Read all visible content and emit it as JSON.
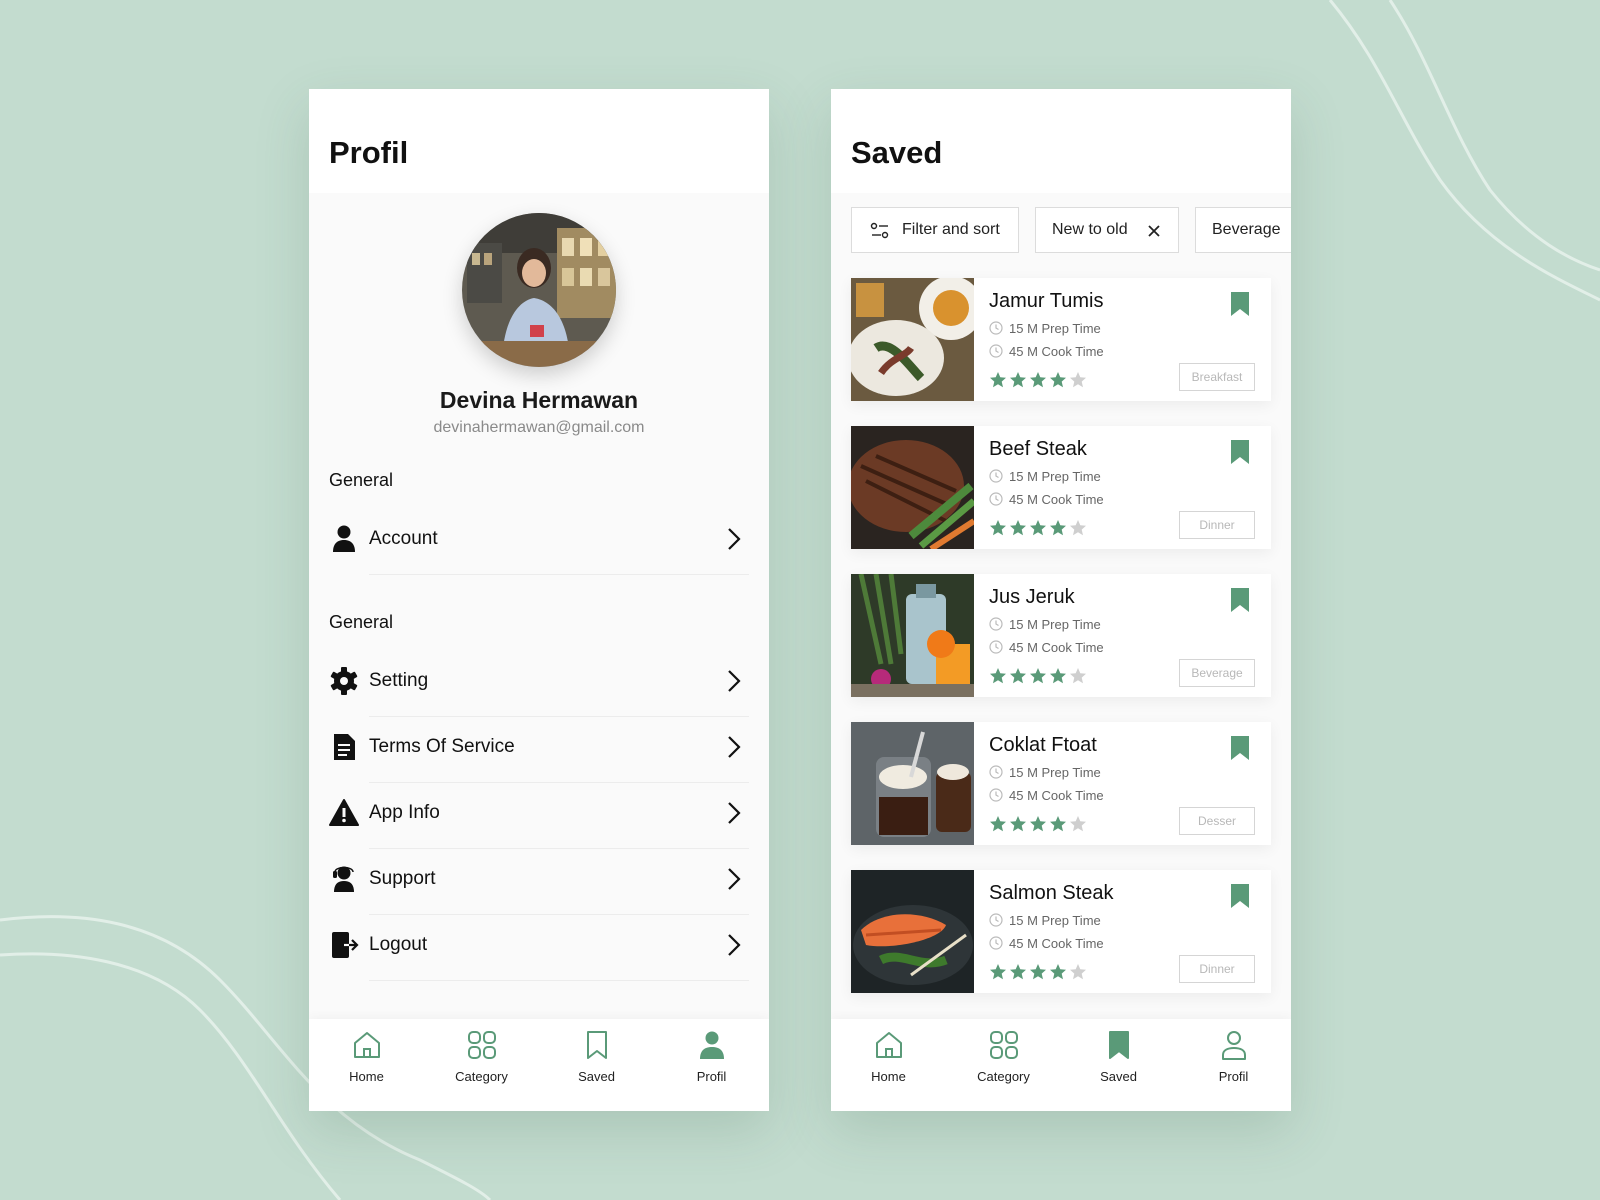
{
  "colors": {
    "accent": "#5a9a78",
    "background": "#c3dccf",
    "text": "#111111",
    "muted": "#8a8a8a"
  },
  "profile_screen": {
    "title": "Profil",
    "user": {
      "name": "Devina Hermawan",
      "email": "devinahermawan@gmail.com"
    },
    "sections": [
      {
        "label": "General",
        "items": [
          {
            "label": "Account",
            "icon": "user-icon"
          }
        ]
      },
      {
        "label": "General",
        "items": [
          {
            "label": "Setting",
            "icon": "gear-icon"
          },
          {
            "label": "Terms Of Service",
            "icon": "document-icon"
          },
          {
            "label": "App Info",
            "icon": "warning-icon"
          },
          {
            "label": "Support",
            "icon": "support-icon"
          },
          {
            "label": "Logout",
            "icon": "logout-icon"
          }
        ]
      }
    ],
    "nav": {
      "active": "Profil",
      "items": [
        "Home",
        "Category",
        "Saved",
        "Profil"
      ]
    }
  },
  "saved_screen": {
    "title": "Saved",
    "chips": [
      {
        "label": "Filter and sort",
        "icon": "filter-icon"
      },
      {
        "label": "New to old",
        "icon": "close-icon"
      },
      {
        "label": "Beverage"
      }
    ],
    "recipes": [
      {
        "name": "Jamur Tumis",
        "prep": "15 M Prep Time",
        "cook": "45 M Cook Time",
        "rating": 4,
        "tag": "Breakfast"
      },
      {
        "name": "Beef Steak",
        "prep": "15 M Prep Time",
        "cook": "45 M Cook Time",
        "rating": 4,
        "tag": "Dinner"
      },
      {
        "name": "Jus Jeruk",
        "prep": "15 M Prep Time",
        "cook": "45 M Cook Time",
        "rating": 4,
        "tag": "Beverage"
      },
      {
        "name": "Coklat Ftoat",
        "prep": "15 M Prep Time",
        "cook": "45 M Cook Time",
        "rating": 4,
        "tag": "Desser"
      },
      {
        "name": "Salmon Steak",
        "prep": "15 M Prep Time",
        "cook": "45 M Cook Time",
        "rating": 4,
        "tag": "Dinner"
      }
    ],
    "nav": {
      "active": "Saved",
      "items": [
        "Home",
        "Category",
        "Saved",
        "Profil"
      ]
    }
  }
}
